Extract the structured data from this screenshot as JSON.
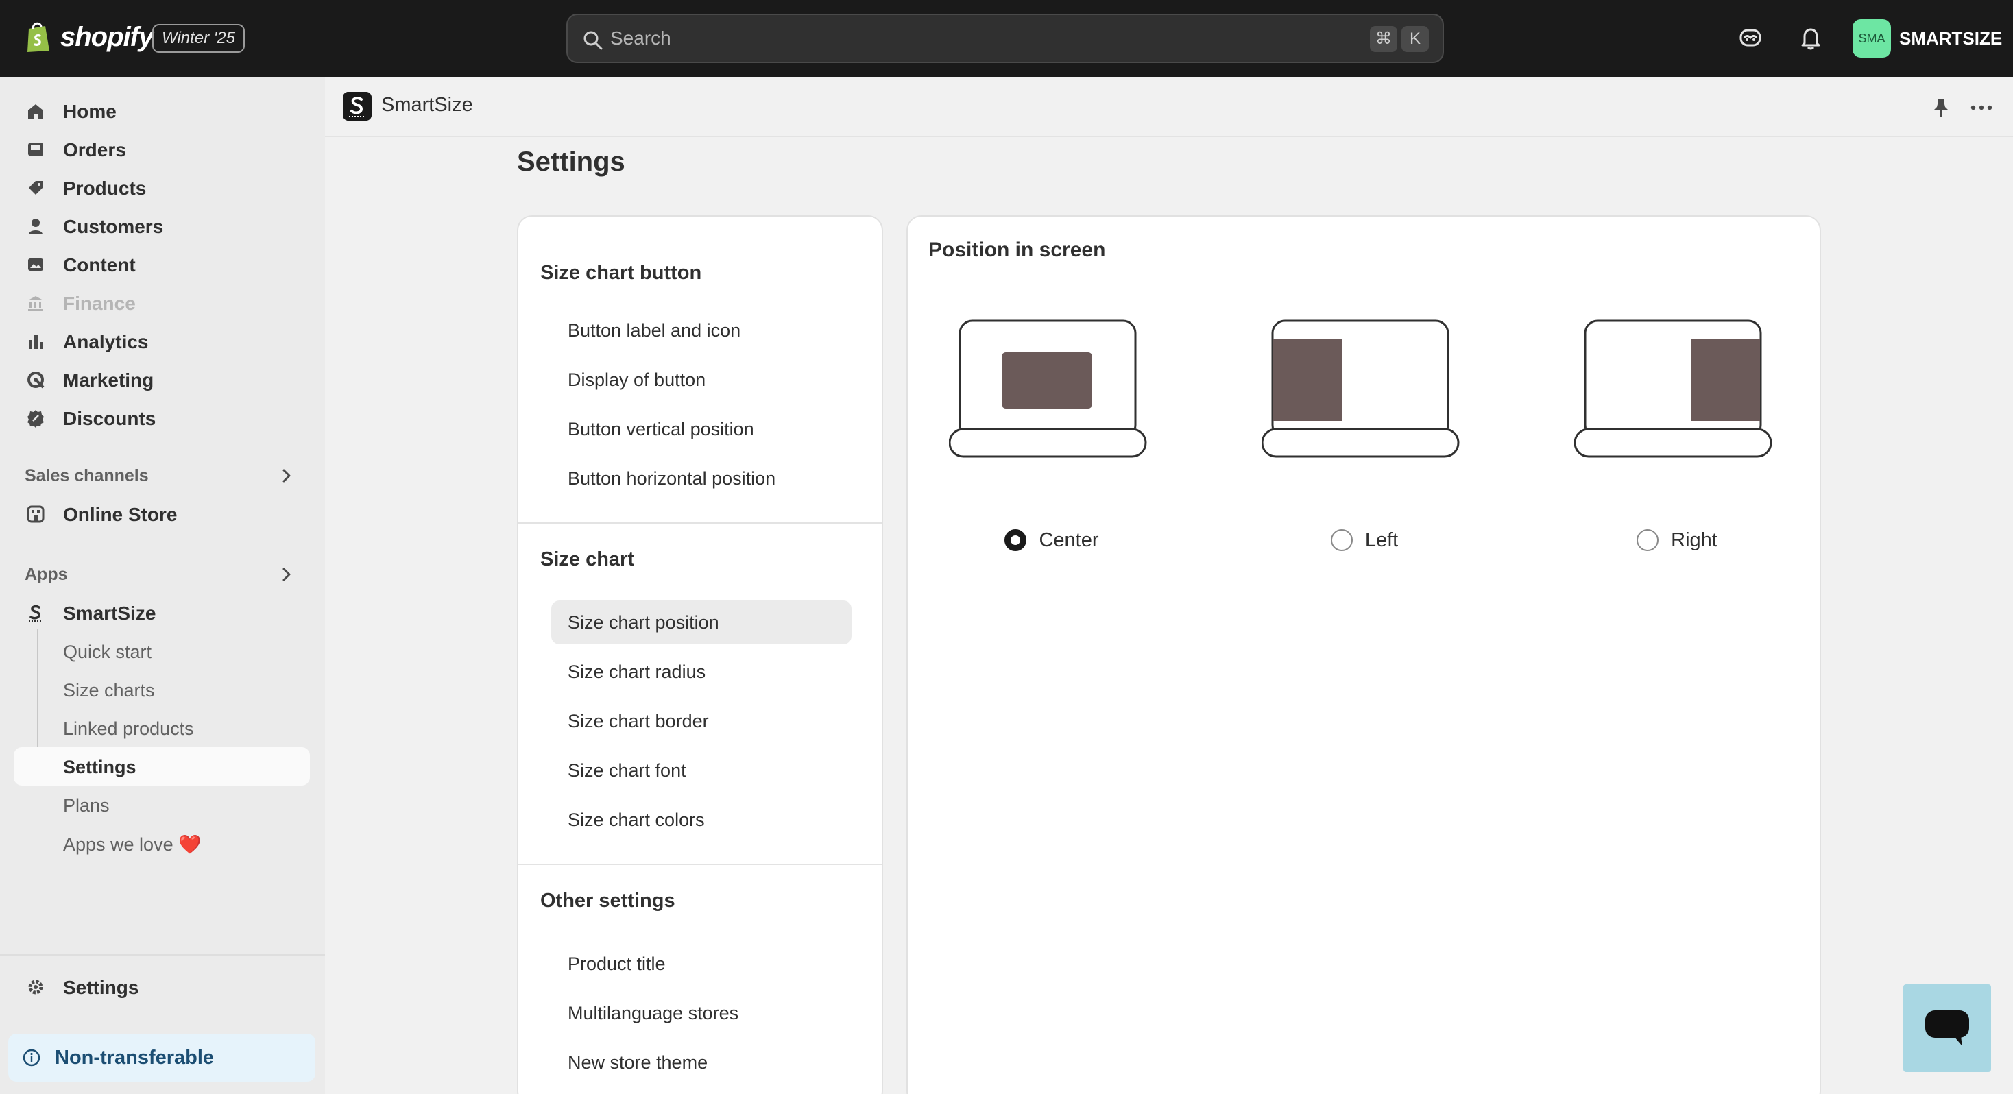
{
  "topbar": {
    "brand": "shopify",
    "edition": "Winter '25",
    "search_placeholder": "Search",
    "shortcut_cmd": "⌘",
    "shortcut_key": "K",
    "avatar_initials": "SMA",
    "store_name": "SMARTSIZE"
  },
  "sidebar": {
    "main": [
      {
        "label": "Home",
        "icon": "home-icon"
      },
      {
        "label": "Orders",
        "icon": "inbox-icon"
      },
      {
        "label": "Products",
        "icon": "tag-icon"
      },
      {
        "label": "Customers",
        "icon": "person-icon"
      },
      {
        "label": "Content",
        "icon": "image-icon"
      },
      {
        "label": "Finance",
        "icon": "bank-icon",
        "disabled": true
      },
      {
        "label": "Analytics",
        "icon": "bar-chart-icon"
      },
      {
        "label": "Marketing",
        "icon": "target-icon"
      },
      {
        "label": "Discounts",
        "icon": "discount-icon"
      }
    ],
    "sales_channels_label": "Sales channels",
    "online_store_label": "Online Store",
    "apps_label": "Apps",
    "app_name": "SmartSize",
    "app_subitems": [
      "Quick start",
      "Size charts",
      "Linked products",
      "Settings",
      "Plans",
      "Apps we love ❤️"
    ],
    "active_subitem": "Settings",
    "settings_label": "Settings",
    "notice_label": "Non-transferable"
  },
  "appbar": {
    "title": "SmartSize"
  },
  "page": {
    "title": "Settings",
    "menu": {
      "sections": [
        {
          "heading": "Size chart button",
          "items": [
            "Button label and icon",
            "Display of button",
            "Button vertical position",
            "Button horizontal position"
          ]
        },
        {
          "heading": "Size chart",
          "items": [
            "Size chart position",
            "Size chart radius",
            "Size chart border",
            "Size chart font",
            "Size chart colors"
          ]
        },
        {
          "heading": "Other settings",
          "items": [
            "Product title",
            "Multilanguage stores",
            "New store theme"
          ]
        }
      ],
      "active_item": "Size chart position"
    },
    "position": {
      "title": "Position in screen",
      "options": [
        {
          "label": "Center",
          "selected": true
        },
        {
          "label": "Left",
          "selected": false
        },
        {
          "label": "Right",
          "selected": false
        }
      ]
    }
  },
  "colors": {
    "topbar_bg": "#1a1a1a",
    "panel_fill": "#6b5a59",
    "avatar_bg": "#6de6a3",
    "notice_bg": "#e6f3fb",
    "chat_bg": "#a9d7e3"
  }
}
